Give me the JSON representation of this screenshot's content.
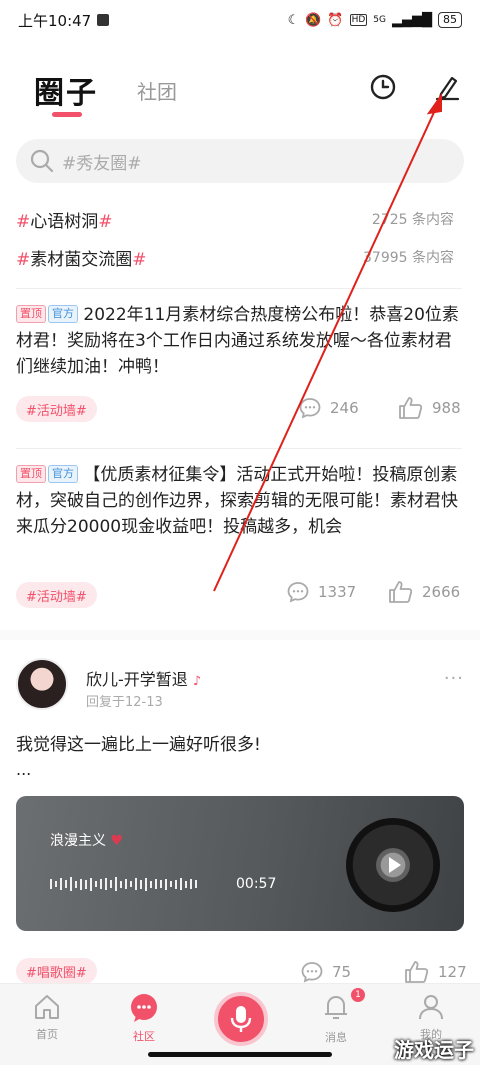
{
  "status_bar": {
    "time": "上午10:47",
    "network": "5G",
    "battery": "85"
  },
  "header": {
    "tab_active": "圈子",
    "tab_inactive": "社团"
  },
  "search": {
    "placeholder": "#秀友圈#"
  },
  "topics": [
    {
      "hash_left": "#",
      "name": "心语树洞",
      "hash_right": "#",
      "count": "2725 条内容"
    },
    {
      "hash_left": "#",
      "name": "素材菌交流圈",
      "hash_right": "#",
      "count": "37995 条内容"
    }
  ],
  "posts": [
    {
      "pin_tag": "置顶",
      "official_tag": "官方",
      "text": "2022年11月素材综合热度榜公布啦！恭喜20位素材君！奖励将在3个工作日内通过系统发放喔～各位素材君们继续加油！冲鸭！",
      "topic_tag": "#活动墙#",
      "comments": "246",
      "likes": "988"
    },
    {
      "pin_tag": "置顶",
      "official_tag": "官方",
      "text": "【优质素材征集令】活动正式开始啦！投稿原创素材，突破自己的创作边界，探索剪辑的无限可能！素材君快来瓜分20000现金收益吧！投稿越多，机会",
      "topic_tag": "#活动墙#",
      "comments": "1337",
      "likes": "2666"
    }
  ],
  "user_post": {
    "user_name": "欣儿-开学暂退",
    "reply_time": "回复于12-13",
    "more": "···",
    "text": "我觉得这一遍比上一遍好听很多!",
    "ellipsis": "...",
    "song_title": "浪漫主义",
    "song_duration": "00:57",
    "topic_tag": "#唱歌圈#",
    "comments": "75",
    "likes": "127"
  },
  "bottom_nav": {
    "home": "首页",
    "community": "社区",
    "messages": "消息",
    "messages_badge": "1",
    "mine": "我的"
  },
  "watermark": "游戏运子",
  "colors": {
    "accent": "#f2516a",
    "annotation": "#e0201a"
  }
}
